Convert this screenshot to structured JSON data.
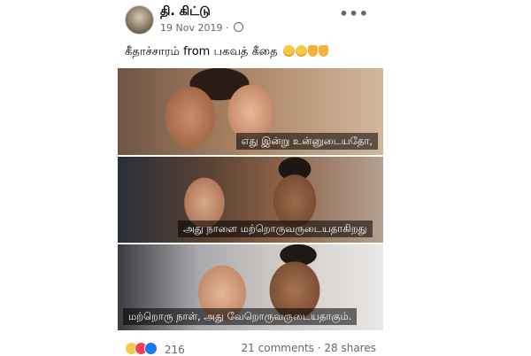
{
  "post": {
    "author": "தி. கிட்டு",
    "date": "19 Nov 2019",
    "date_separator": "·",
    "more_icon": "•••",
    "caption": "கீதாச்சாரம் from பகவத் கீதை",
    "caption_emojis": [
      "laughing-emoji",
      "laughing-emoji",
      "pointing-down-emoji",
      "pointing-down-emoji"
    ]
  },
  "photos": [
    {
      "subtitle": "எது இன்று உன்னுடையதோ,"
    },
    {
      "subtitle": "அது நாளை மற்றொருவருடையதாகிறது"
    },
    {
      "subtitle": "மற்றொரு நாள், அது வேறொருவருடையதாகும்."
    }
  ],
  "footer": {
    "reaction_icons": [
      "haha-icon",
      "love-icon",
      "like-icon"
    ],
    "reaction_count": "216",
    "comments": "21 comments",
    "separator": "·",
    "shares": "28 shares"
  }
}
